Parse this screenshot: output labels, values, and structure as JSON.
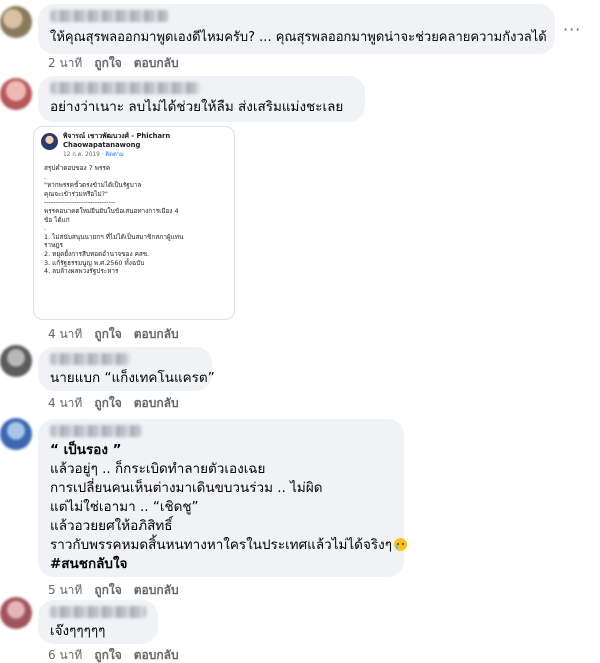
{
  "comments": [
    {
      "text": "ให้คุณสุรพลออกมาพูดเองดีไหมครับ? ... คุณสุรพลออกมาพูดน่าจะช่วยคลายความกังวลได้",
      "time": "2 นาที"
    },
    {
      "text": "อย่างว่าเนาะ ลบไม่ได้ช่วยให้ลืม ส่งเสริมแม่งชะเลย",
      "time": "4 นาที",
      "shared_post": {
        "author": "พิจารณ์ เชาวพัฒนวงศ์ - Phicharn Chaowapatanawong",
        "follow_label": "ติดตาม",
        "date": "12 ก.ค. 2019 · ",
        "lines": [
          "สรุปคำตอบของ 7 พรรค",
          ".",
          "\"หากพรรคขั้วตรงข้ามได้เป็นรัฐบาล",
          "คุณจะเข้าร่วมหรือไม่?\"",
          "-------------------------------",
          "พรรคอนาคตใหม่ยืนยันในข้อเสนอทางการเมือง 4",
          "ข้อ ได้แก่",
          ".",
          "1. ไม่สนับสนุนนายกฯ ที่ไม่ได้เป็นสมาชิกสภาผู้แทน",
          "ราษฎร",
          "2. หยุดยั้งการสืบทอดอำนาจของ คสช.",
          "3. แก้รัฐธรรมนูญ พ.ศ.2560 ทั้งฉบับ",
          "4. ลบล้างผลพวงรัฐประหาร"
        ]
      }
    },
    {
      "text": "นายแบก “แก็งเทคโนแครต”",
      "time": "4 นาที"
    },
    {
      "lines": [
        "“ เป็นรอง ”",
        "แล้วอยู่ๆ .. ก็กระเบิดทำลายตัวเองเฉย",
        "การเปลี่ยนคนเห็นต่างมาเดินขบวนร่วม .. ไม่ผิด",
        "แต่ไม่ใช่เอามา .. “เชิดชู”",
        "แล้วอวยยศให้อภิสิทธิ์",
        "ราวกับพรรคหมดสิ้นหนทางหาใครในประเทศแล้วไม่ได้จริงๆ",
        "#สนชกลับใจ"
      ],
      "emoji": "crying-face-emoji",
      "time": "5 นาที"
    },
    {
      "text": "เจ๊งๆๆๆๆๆ",
      "time": "6 นาที"
    }
  ],
  "actions": {
    "like": "ถูกใจ",
    "reply": "ตอบกลับ"
  },
  "more_icon": "···",
  "colors": {
    "bubble": "#f0f2f5",
    "meta_text": "#65676b",
    "link": "#1877f2"
  }
}
